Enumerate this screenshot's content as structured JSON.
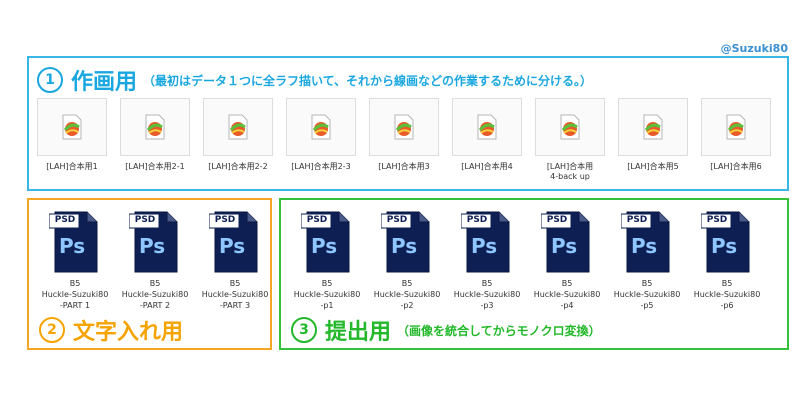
{
  "credit": "@Suzuki80",
  "work_section": {
    "number": "1",
    "title": "作画用",
    "note": "（最初はデータ１つに全ラフ描いて、それから線画などの作業するために分ける。）",
    "files": [
      {
        "label": "[LAH]合本用1"
      },
      {
        "label": "[LAH]合本用2-1"
      },
      {
        "label": "[LAH]合本用2-2"
      },
      {
        "label": "[LAH]合本用2-3"
      },
      {
        "label": "[LAH]合本用3"
      },
      {
        "label": "[LAH]合本用4"
      },
      {
        "label": "[LAH]合本用\n4-back up"
      },
      {
        "label": "[LAH]合本用5"
      },
      {
        "label": "[LAH]合本用6"
      }
    ]
  },
  "text_section": {
    "number": "2",
    "title": "文字入れ用",
    "files": [
      {
        "label": "B5\nHuckle-Suzuki80\n-PART 1"
      },
      {
        "label": "B5\nHuckle-Suzuki80\n-PART 2"
      },
      {
        "label": "B5\nHuckle-Suzuki80\n-PART 3"
      }
    ]
  },
  "submit_section": {
    "number": "3",
    "title": "提出用",
    "note": "（画像を統合してからモノクロ変換）",
    "files": [
      {
        "label": "B5\nHuckle-Suzuki80\n-p1"
      },
      {
        "label": "B5\nHuckle-Suzuki80\n-p2"
      },
      {
        "label": "B5\nHuckle-Suzuki80\n-p3"
      },
      {
        "label": "B5\nHuckle-Suzuki80\n-p4"
      },
      {
        "label": "B5\nHuckle-Suzuki80\n-p5"
      },
      {
        "label": "B5\nHuckle-Suzuki80\n-p6"
      }
    ]
  },
  "psd_icon": {
    "badge": "PSD",
    "mark": "Ps"
  },
  "colors": {
    "work": "#39b7e6",
    "text": "#f5a623",
    "submit": "#35c13a",
    "psd_bg": "#0e1f53",
    "psd_text": "#8fc6ff"
  }
}
